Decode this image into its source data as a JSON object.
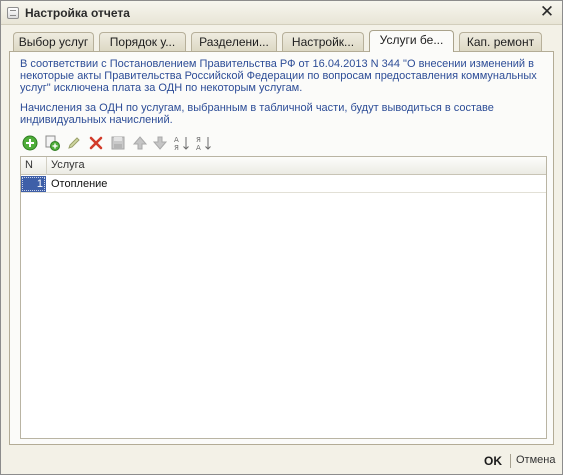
{
  "window": {
    "title": "Настройка отчета",
    "close_glyph": "✕"
  },
  "tabs": [
    {
      "label": "Выбор услуг",
      "active": false
    },
    {
      "label": "Порядок у...",
      "active": false
    },
    {
      "label": "Разделени...",
      "active": false
    },
    {
      "label": "Настройк...",
      "active": false
    },
    {
      "label": "Услуги бе...",
      "active": true
    },
    {
      "label": "Кап. ремонт",
      "active": false
    }
  ],
  "info": {
    "paragraph1": "В соответствии с Постановлением Правительства РФ от 16.04.2013 N 344 \"О внесении изменений в некоторые акты Правительства Российской Федерации по вопросам предоставления коммунальных услуг\" исключена плата за ОДН по некоторым услугам.",
    "paragraph2": "Начисления за ОДН по услугам, выбранным в табличной части, будут выводиться в составе индивидуальных начислений."
  },
  "toolbar": {
    "icons": [
      "add-icon",
      "copy-icon",
      "edit-icon",
      "delete-icon",
      "end-edit-icon",
      "move-up-icon",
      "move-down-icon",
      "sort-asc-icon",
      "sort-desc-icon"
    ]
  },
  "table": {
    "columns": [
      "N",
      "Услуга"
    ],
    "rows": [
      {
        "n": "1",
        "service": "Отопление"
      }
    ]
  },
  "footer": {
    "ok_label": "OK",
    "cancel_label": "Отмена"
  },
  "colors": {
    "info_text": "#2d4d97",
    "selection": "#3e5fa8",
    "window_bg": "#f3f1e7"
  }
}
